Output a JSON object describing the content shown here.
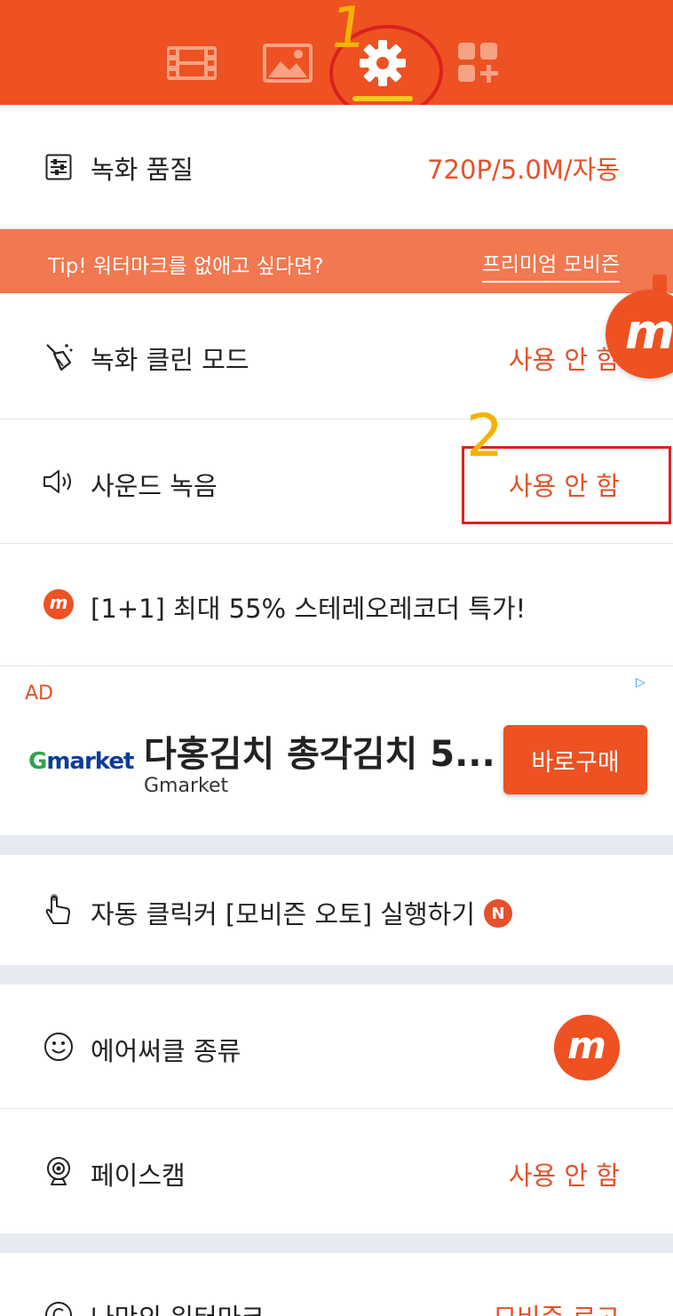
{
  "tabs": [
    {
      "name": "video",
      "icon": "film-icon"
    },
    {
      "name": "image",
      "icon": "image-icon"
    },
    {
      "name": "settings",
      "icon": "gear-icon",
      "active": true
    },
    {
      "name": "tools",
      "icon": "apps-add-icon"
    }
  ],
  "annotations": {
    "first": "1",
    "second": "2"
  },
  "settings": {
    "quality": {
      "label": "녹화 품질",
      "value": "720P/5.0M/자동"
    },
    "tip": {
      "text": "Tip! 워터마크를 없애고 싶다면?",
      "link": "프리미엄 모비즌"
    },
    "clean_mode": {
      "label": "녹화 클린 모드",
      "value": "사용 안 함"
    },
    "sound": {
      "label": "사운드 녹음",
      "value": "사용 안 함"
    },
    "promo": {
      "label": "[1+1] 최대 55% 스테레오레코더 특가!"
    },
    "auto_click": {
      "label": "자동 클릭커 [모비즌 오토] 실행하기",
      "badge": "N"
    },
    "aircircle": {
      "label": "에어써클 종류"
    },
    "facecam": {
      "label": "페이스캠",
      "value": "사용 안 함"
    },
    "watermark": {
      "label": "나만의 워터마크",
      "value": "모비즌 로고"
    }
  },
  "ad": {
    "label": "AD",
    "brand": "Gmarket",
    "headline": "다홍김치 총각김치 5...",
    "advertiser": "Gmarket",
    "cta": "바로구매"
  },
  "logo_letter": "m",
  "colors": {
    "accent": "#ee5122",
    "value_text": "#e4512a",
    "tip_bg": "#f27850",
    "underline": "#f7c91a"
  }
}
